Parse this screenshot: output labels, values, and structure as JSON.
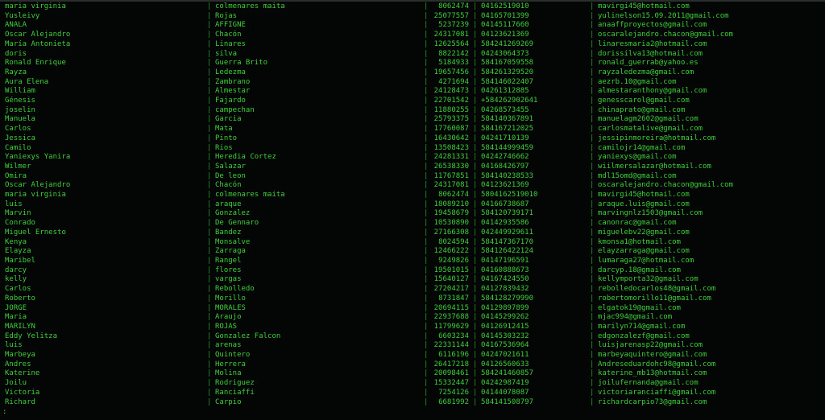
{
  "terminal": {
    "separator": "|",
    "prompt": ":",
    "text_color": "#3ecf3a",
    "background": "#040605",
    "rows": [
      [
        "maria virginia",
        "colmenares maita",
        "8062474",
        "04162519010",
        "mavirgi45@hotmail.com"
      ],
      [
        "Yusleivy",
        "Rojas",
        "25077557",
        "04165701399",
        "yulinelson15.09.2011@gmail.com"
      ],
      [
        "ANALA",
        "AFFIGNE",
        "5237239",
        "04145117660",
        "anaaffproyectos@gmail.com"
      ],
      [
        "Oscar Alejandro",
        "Chacón",
        "24317081",
        "04123621369",
        "oscaralejandro.chacon@gmail.com"
      ],
      [
        "María Antonieta",
        "Linares",
        "12625564",
        "584241269269",
        "linaresmaria2@hotmail.com"
      ],
      [
        "doris",
        "silva",
        "8822142",
        "04243064373",
        "dorissilva13@hotmail.com"
      ],
      [
        "Ronald Enrique",
        "Guerra Brito",
        "5184933",
        "584167059558",
        "ronald_guerrab@yahoo.es"
      ],
      [
        "Rayza",
        "Ledezma",
        "19657456",
        "584261329520",
        "rayzaledezma@gmail.com"
      ],
      [
        "Aura Elena",
        "Zambrano",
        "4271694",
        "584146022407",
        "aezrb.10@gmail.com"
      ],
      [
        "William",
        "Almestar",
        "24128473",
        "04261312885",
        "almestaranthony@gmail.com"
      ],
      [
        "Génesis",
        "Fajardo",
        "22701542",
        "+584262902641",
        "genesscarol@gmail.com"
      ],
      [
        "joselin",
        "campechan",
        "11880255",
        "04268573455",
        "chinaprato@gmail.com"
      ],
      [
        "Manuela",
        "Garcia",
        "25793375",
        "584140367891",
        "manuelagm2602@gmail.com"
      ],
      [
        "Carlos",
        "Mata",
        "17760087",
        "584167212025",
        "carlosmatalive@gmail.com"
      ],
      [
        "Jessica",
        "Pinto",
        "16430642",
        "04241710139",
        "jessipinmoreira@hotmail.com"
      ],
      [
        "Camilo",
        "Rios",
        "13508423",
        "584144999459",
        "camilojr14@gmail.com"
      ],
      [
        "Yaniexys Yanira",
        "Heredia Cortez",
        "24281331",
        "04242746662",
        "yaniexys@gmail.com"
      ],
      [
        "Wilmer",
        "Salazar",
        "26538330",
        "04168426797",
        "wiilmersalazar@hotmail.com"
      ],
      [
        "Omira",
        "De leon",
        "11767851",
        "584140238533",
        "mdl15omd@gmail.com"
      ],
      [
        "Oscar Alejandro",
        "Chacón",
        "24317081",
        "04123621369",
        "oscaralejandro.chacon@gmail.com"
      ],
      [
        "maria virginia",
        "colmenares maita",
        "8062474",
        "5804162519010",
        "mavirgi45@hotmail.com"
      ],
      [
        "luis",
        "araque",
        "18089210",
        "04166738687",
        "araque.luis@gmail.com"
      ],
      [
        "Marvin",
        "Gonzalez",
        "19458679",
        "584120739171",
        "marvingnlz1503@gmail.com"
      ],
      [
        "Conrado",
        "De Gennaro",
        "10530890",
        "04142935586",
        "canonrac@gmail.com"
      ],
      [
        "Miguel Ernesto",
        "Bandez",
        "27166308",
        "042449929611",
        "miguelebv22@gmail.com"
      ],
      [
        "Kenya",
        "Monsalve",
        "8024594",
        "584147367170",
        "kmonsa1@hotmail.com"
      ],
      [
        "Elayza",
        "Zarraga",
        "12466222",
        "584126422124",
        "elayzarraga@gmail.com"
      ],
      [
        "Maribel",
        "Rangel",
        "9249826",
        "04147196591",
        "lumaraga27@hotmail.com"
      ],
      [
        "darcy",
        "flores",
        "19501015",
        "04160888673",
        "darcyp.18@gmail.com"
      ],
      [
        "kelly",
        "vargas",
        "15640127",
        "04167424550",
        "kellymporta32@gmail.com"
      ],
      [
        "Carlos",
        "Rebolledo",
        "27204217",
        "04127839432",
        "rebolledocarlos48@gmail.com"
      ],
      [
        "Roberto",
        "Morillo",
        "8731847",
        "584128279990",
        "robertomorillo11@gmail.com"
      ],
      [
        "JORGE",
        "MORALES",
        "20694115",
        "04129897899",
        "elgatok19@gmail.com"
      ],
      [
        "Maria",
        "Araujo",
        "22937688",
        "04145299262",
        "mjac994@gmail.com"
      ],
      [
        "MARILYN",
        "ROJAS",
        "11799629",
        "04126912415",
        "marilyn714@gmail.com"
      ],
      [
        "Eddy Yelitza",
        "Gonzalez Falcon",
        "6603234",
        "04145303232",
        "edgonzalezf@gmail.com"
      ],
      [
        "luis",
        "arenas",
        "22331144",
        "04167536964",
        "luisjarenasp22@gmail.com"
      ],
      [
        "Marbeya",
        "Quintero",
        "6116196",
        "04247021611",
        "marbeyaquintero@gmail.com"
      ],
      [
        "Andres",
        "Herrera",
        "26417218",
        "04126560633",
        "Andreseduardohc98@gmail.com"
      ],
      [
        "Katerine",
        "Molina",
        "20098461",
        "584241460857",
        "katerine_mb13@hotmail.com"
      ],
      [
        "Joilu",
        "Rodriguez",
        "15332447",
        "04242987419",
        "joilufernanda@gmail.com"
      ],
      [
        "Victoria",
        "Ranciaffi",
        "7254126",
        "04144078087",
        "victoriaranciaffi@gmail.com"
      ],
      [
        "Richard",
        "Carpio",
        "6681992",
        "584141508797",
        "richardcarpio73@gmail.com"
      ]
    ]
  }
}
